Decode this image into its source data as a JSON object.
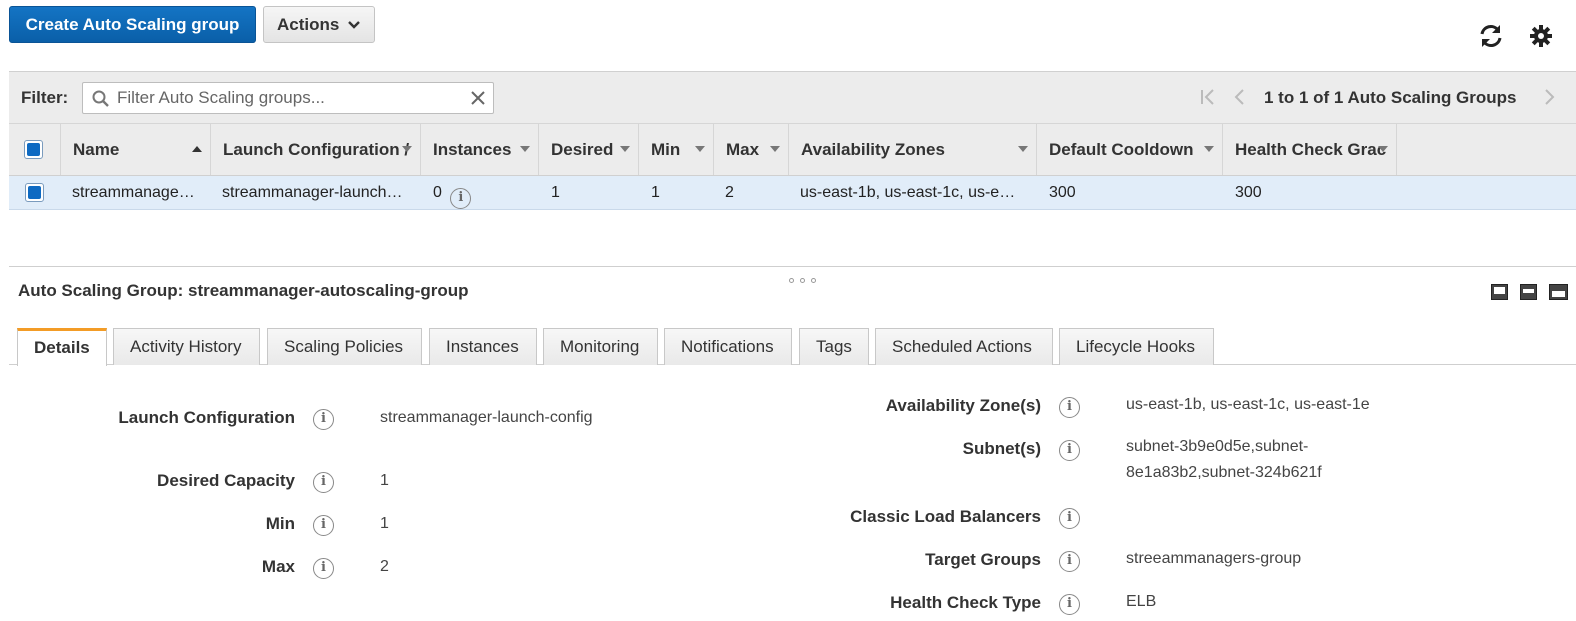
{
  "toolbar": {
    "create_label": "Create Auto Scaling group",
    "actions_label": "Actions"
  },
  "filter": {
    "label": "Filter:",
    "placeholder": "Filter Auto Scaling groups..."
  },
  "pager": {
    "text": "1 to 1 of 1 Auto Scaling Groups"
  },
  "table": {
    "columns": [
      "Name",
      "Launch Configuration /",
      "Instances",
      "Desired",
      "Min",
      "Max",
      "Availability Zones",
      "Default Cooldown",
      "Health Check Grac"
    ],
    "rows": [
      {
        "name": "streammanage…",
        "launch_config": "streammanager-launch…",
        "instances": "0",
        "desired": "1",
        "min": "1",
        "max": "2",
        "zones": "us-east-1b, us-east-1c, us-e…",
        "cooldown": "300",
        "grace": "300"
      }
    ]
  },
  "detail": {
    "title": "Auto Scaling Group: streammanager-autoscaling-group",
    "tabs": [
      "Details",
      "Activity History",
      "Scaling Policies",
      "Instances",
      "Monitoring",
      "Notifications",
      "Tags",
      "Scheduled Actions",
      "Lifecycle Hooks"
    ],
    "active_tab": "Details",
    "left": [
      {
        "label": "Launch Configuration",
        "value": "streammanager-launch-config"
      },
      {
        "label": "Desired Capacity",
        "value": "1"
      },
      {
        "label": "Min",
        "value": "1"
      },
      {
        "label": "Max",
        "value": "2"
      }
    ],
    "right": [
      {
        "label": "Availability Zone(s)",
        "value": "us-east-1b, us-east-1c, us-east-1e"
      },
      {
        "label": "Subnet(s)",
        "value": "subnet-3b9e0d5e,subnet-8e1a83b2,subnet-324b621f"
      },
      {
        "label": "Classic Load Balancers",
        "value": ""
      },
      {
        "label": "Target Groups",
        "value": "streeammanagers-group"
      },
      {
        "label": "Health Check Type",
        "value": "ELB"
      }
    ]
  },
  "colors": {
    "primary": "#0a5fa8",
    "selected_row": "#e1edf9",
    "active_tab_accent": "#f39c26"
  },
  "icons": [
    "refresh-icon",
    "gear-icon",
    "search-icon",
    "clear-icon",
    "first-page-icon",
    "prev-page-icon",
    "next-page-icon",
    "sort-asc-icon",
    "sort-dropdown-icon",
    "info-icon"
  ]
}
